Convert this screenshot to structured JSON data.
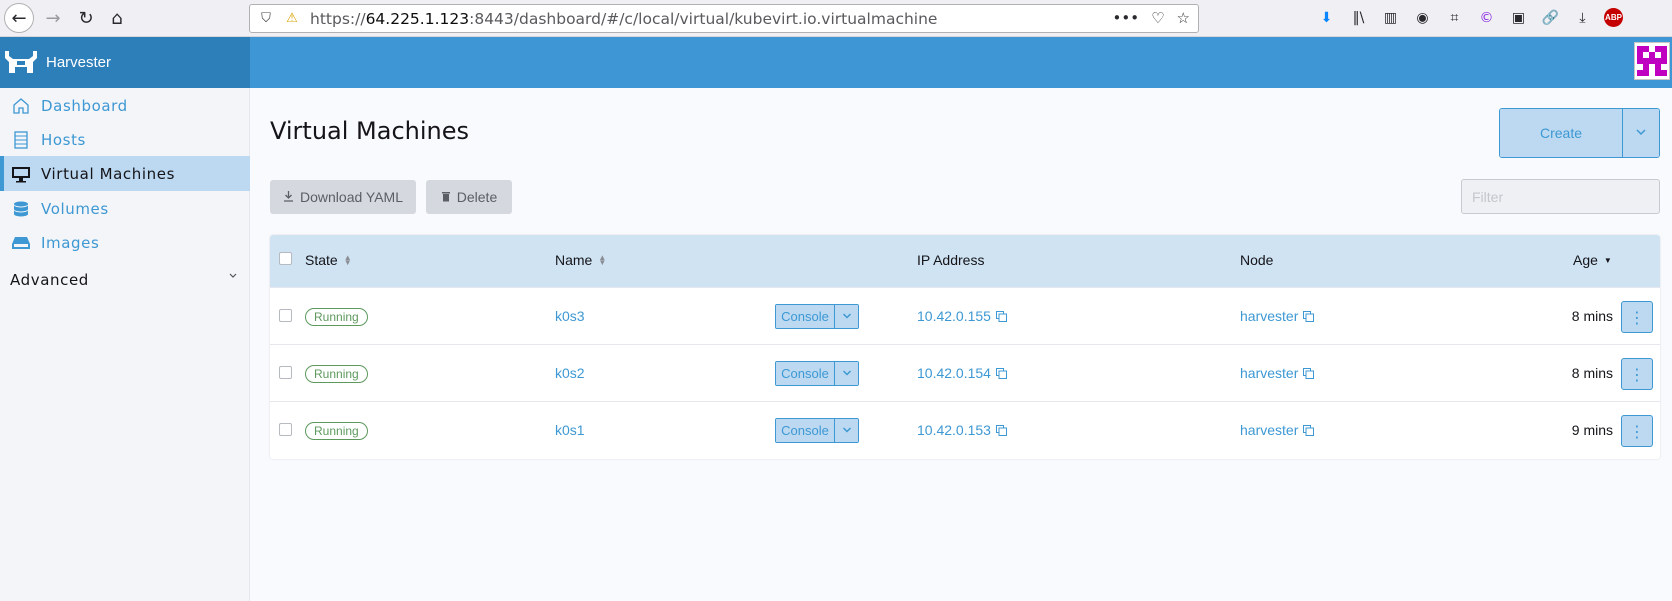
{
  "browser": {
    "url_prefix": "https://",
    "url_host": "64.225.1.123",
    "url_rest": ":8443/dashboard/#/c/local/virtual/kubevirt.io.virtualmachine",
    "abp_label": "ABP"
  },
  "app": {
    "brand_name": "Harvester"
  },
  "sidebar": {
    "items": [
      {
        "label": "Dashboard",
        "icon": "home-icon"
      },
      {
        "label": "Hosts",
        "icon": "server-icon"
      },
      {
        "label": "Virtual Machines",
        "icon": "monitor-icon",
        "active": true
      },
      {
        "label": "Volumes",
        "icon": "database-icon"
      },
      {
        "label": "Images",
        "icon": "disk-tray-icon"
      }
    ],
    "group_label": "Advanced"
  },
  "main": {
    "title": "Virtual Machines",
    "create_label": "Create",
    "download_yaml_label": "Download YAML",
    "delete_label": "Delete",
    "filter_placeholder": "Filter"
  },
  "table": {
    "columns": {
      "state": "State",
      "name": "Name",
      "ip": "IP Address",
      "node": "Node",
      "age": "Age"
    },
    "rows": [
      {
        "state": "Running",
        "name": "k0s3",
        "console": "Console",
        "ip": "10.42.0.155",
        "node": "harvester",
        "age": "8 mins"
      },
      {
        "state": "Running",
        "name": "k0s2",
        "console": "Console",
        "ip": "10.42.0.154",
        "node": "harvester",
        "age": "8 mins"
      },
      {
        "state": "Running",
        "name": "k0s1",
        "console": "Console",
        "ip": "10.42.0.153",
        "node": "harvester",
        "age": "9 mins"
      }
    ]
  },
  "colors": {
    "accent": "#3d98d3",
    "header": "#3e96d4",
    "brand": "#2d7fba",
    "running": "#5d995d",
    "avatar": "#c000c0"
  }
}
